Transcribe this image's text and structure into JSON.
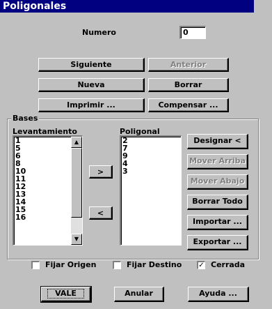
{
  "window": {
    "title": "Poligonales"
  },
  "numero": {
    "label": "Numero",
    "value": "0"
  },
  "buttons": {
    "siguiente": "Siguiente",
    "anterior": "Anterior",
    "nueva": "Nueva",
    "borrar": "Borrar",
    "imprimir": "Imprimir ...",
    "compensar": "Compensar ..."
  },
  "bases": {
    "group_title": "Bases",
    "levantamiento": {
      "label": "Levantamiento",
      "items": [
        "1",
        "5",
        "6",
        "8",
        "10",
        "11",
        "12",
        "13",
        "14",
        "15",
        "16"
      ]
    },
    "poligonal": {
      "label": "Poligonal",
      "items": [
        "2",
        "7",
        "9",
        "4",
        "3"
      ]
    },
    "move_right": ">",
    "move_left": "<",
    "designar": "Designar <",
    "mover_arriba": "Mover Arriba",
    "mover_abajo": "Mover Abajo",
    "borrar_todo": "Borrar Todo",
    "importar": "Importar ...",
    "exportar": "Exportar ..."
  },
  "checks": {
    "fijar_origen": {
      "label": "Fijar Origen",
      "checked": false
    },
    "fijar_destino": {
      "label": "Fijar Destino",
      "checked": false
    },
    "cerrada": {
      "label": "Cerrada",
      "checked": true,
      "mark": "✓"
    }
  },
  "footer": {
    "vale": "VALE",
    "anular": "Anular",
    "ayuda": "Ayuda ..."
  },
  "icons": {
    "scroll_up": "▲",
    "scroll_down": "▼"
  }
}
